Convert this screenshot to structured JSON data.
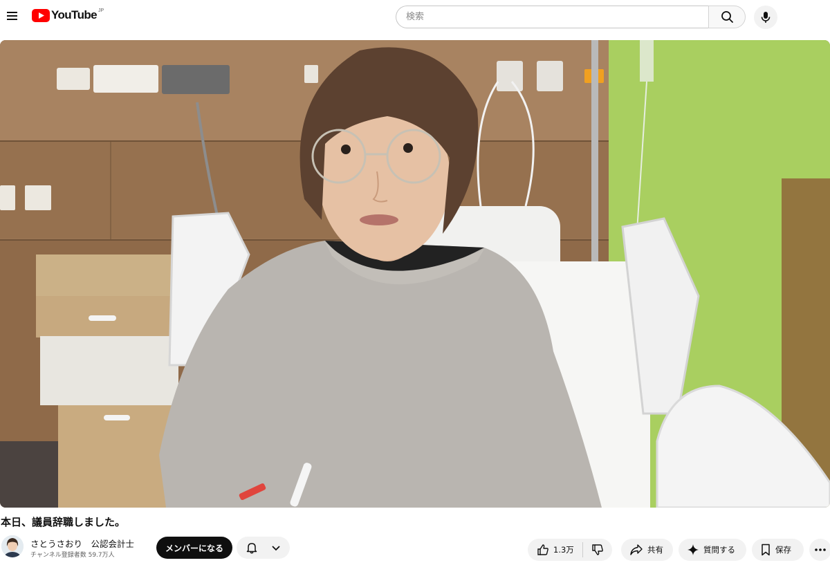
{
  "masthead": {
    "logo_text": "YouTube",
    "logo_region": "JP",
    "search_placeholder": "検索",
    "search_value": ""
  },
  "video": {
    "title": "本日、議員辞職しました。"
  },
  "channel": {
    "name": "さとうさおり　公認会計士",
    "subscribers": "チャンネル登録者数 59.7万人",
    "join_label": "メンバーになる"
  },
  "actions": {
    "like_count": "1.3万",
    "share_label": "共有",
    "ask_label": "質問する",
    "save_label": "保存"
  },
  "icons": {
    "menu": "hamburger-menu-icon",
    "search": "search-icon",
    "mic": "microphone-icon",
    "bell": "bell-icon",
    "chevron": "chevron-down-icon",
    "like": "thumbs-up-icon",
    "dislike": "thumbs-down-icon",
    "share": "share-arrow-icon",
    "ask": "sparkle-icon",
    "save": "bookmark-icon",
    "more": "more-horizontal-icon"
  },
  "colors": {
    "brand_red": "#ff0000",
    "join_bg": "#0f0f0f",
    "pill_bg": "#f2f2f2"
  }
}
